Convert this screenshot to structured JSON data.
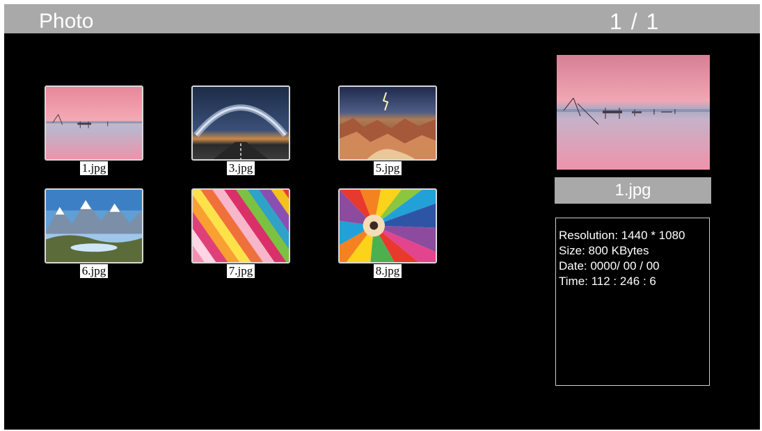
{
  "header": {
    "title": "Photo",
    "page_counter": "1 / 1"
  },
  "thumbnails": [
    {
      "name": "1.jpg",
      "scene": "pink-sunset-lake"
    },
    {
      "name": "3.jpg",
      "scene": "milky-way-road"
    },
    {
      "name": "5.jpg",
      "scene": "canyon-lightning"
    },
    {
      "name": "6.jpg",
      "scene": "mountain-lake"
    },
    {
      "name": "7.jpg",
      "scene": "colored-paper-stripes"
    },
    {
      "name": "8.jpg",
      "scene": "colored-pencils"
    }
  ],
  "preview": {
    "name": "1.jpg",
    "scene": "pink-sunset-lake"
  },
  "info": {
    "resolution": "Resolution: 1440 * 1080",
    "size": "Size: 800 KBytes",
    "date": "Date: 0000/ 00 / 00",
    "time": "Time: 112 : 246 : 6"
  },
  "colors": {
    "background": "#000000",
    "header_bar": "#a9a9a9",
    "label_bg": "#ffffff"
  }
}
